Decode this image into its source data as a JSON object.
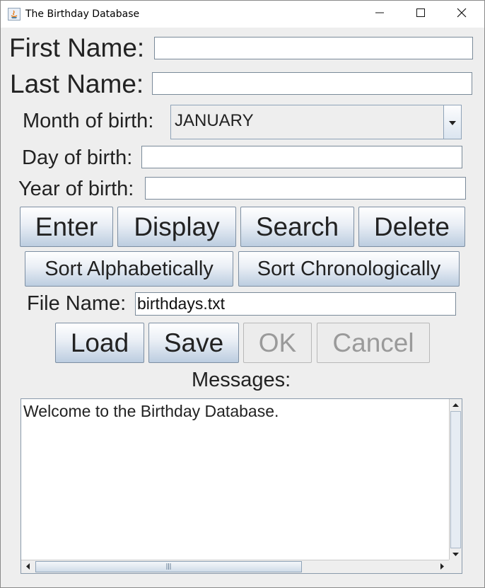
{
  "window": {
    "title": "The Birthday Database",
    "controls": [
      "minimize-icon",
      "maximize-icon",
      "close-icon"
    ]
  },
  "form": {
    "first_name_label": "First Name:",
    "first_name_value": "",
    "last_name_label": "Last Name:",
    "last_name_value": "",
    "month_label": "Month of birth:",
    "month_selected": "JANUARY",
    "day_label": "Day of birth:",
    "day_value": "",
    "year_label": "Year of birth:",
    "year_value": ""
  },
  "actions": {
    "enter": "Enter",
    "display": "Display",
    "search": "Search",
    "delete": "Delete",
    "sort_alpha": "Sort Alphabetically",
    "sort_chrono": "Sort Chronologically"
  },
  "file": {
    "label": "File Name:",
    "value": "birthdays.txt",
    "load": "Load",
    "save": "Save",
    "ok": "OK",
    "cancel": "Cancel"
  },
  "messages": {
    "label": "Messages:",
    "text": "Welcome to the Birthday Database."
  }
}
